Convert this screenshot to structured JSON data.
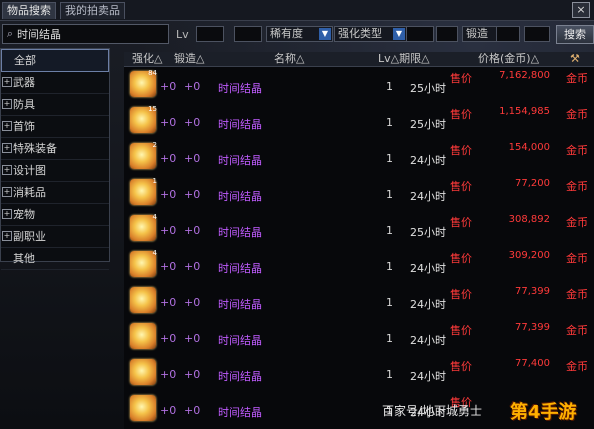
{
  "tabs": [
    {
      "label": "物品搜索"
    },
    {
      "label": "我的拍卖品"
    }
  ],
  "close_label": "×",
  "search": {
    "value": "时间结晶"
  },
  "filters": {
    "lv_label": "Lv",
    "rarity_label": "稀有度",
    "enhance_type_label": "强化类型",
    "forge_label": "锻造",
    "search_button": "搜索"
  },
  "categories": [
    {
      "label": "全部"
    },
    {
      "label": "武器"
    },
    {
      "label": "防具"
    },
    {
      "label": "首饰"
    },
    {
      "label": "特殊装备"
    },
    {
      "label": "设计图"
    },
    {
      "label": "消耗品"
    },
    {
      "label": "宠物"
    },
    {
      "label": "副职业"
    },
    {
      "label": "其他"
    }
  ],
  "columns": {
    "enhance": "强化△",
    "forge": "锻造△",
    "name": "名称△",
    "lv_expire": "Lv△期限△",
    "price": "价格(金币)△"
  },
  "rows": [
    {
      "count": "84",
      "enhance": "+0",
      "forge": "+0",
      "name": "时间结晶",
      "lv": "1",
      "expire": "25小时",
      "sell": "售价",
      "price": "7,162,800",
      "currency": "金币"
    },
    {
      "count": "15",
      "enhance": "+0",
      "forge": "+0",
      "name": "时间结晶",
      "lv": "1",
      "expire": "25小时",
      "sell": "售价",
      "price": "1,154,985",
      "currency": "金币"
    },
    {
      "count": "2",
      "enhance": "+0",
      "forge": "+0",
      "name": "时间结晶",
      "lv": "1",
      "expire": "24小时",
      "sell": "售价",
      "price": "154,000",
      "currency": "金币"
    },
    {
      "count": "1",
      "enhance": "+0",
      "forge": "+0",
      "name": "时间结晶",
      "lv": "1",
      "expire": "24小时",
      "sell": "售价",
      "price": "77,200",
      "currency": "金币"
    },
    {
      "count": "4",
      "enhance": "+0",
      "forge": "+0",
      "name": "时间结晶",
      "lv": "1",
      "expire": "25小时",
      "sell": "售价",
      "price": "308,892",
      "currency": "金币"
    },
    {
      "count": "4",
      "enhance": "+0",
      "forge": "+0",
      "name": "时间结晶",
      "lv": "1",
      "expire": "24小时",
      "sell": "售价",
      "price": "309,200",
      "currency": "金币"
    },
    {
      "count": "",
      "enhance": "+0",
      "forge": "+0",
      "name": "时间结晶",
      "lv": "1",
      "expire": "24小时",
      "sell": "售价",
      "price": "77,399",
      "currency": "金币"
    },
    {
      "count": "",
      "enhance": "+0",
      "forge": "+0",
      "name": "时间结晶",
      "lv": "1",
      "expire": "24小时",
      "sell": "售价",
      "price": "77,399",
      "currency": "金币"
    },
    {
      "count": "",
      "enhance": "+0",
      "forge": "+0",
      "name": "时间结晶",
      "lv": "1",
      "expire": "24小时",
      "sell": "售价",
      "price": "77,400",
      "currency": "金币"
    },
    {
      "count": "",
      "enhance": "+0",
      "forge": "+0",
      "name": "时间结晶",
      "lv": "1",
      "expire": "24小时",
      "sell": "售价",
      "price": "",
      "currency": ""
    }
  ],
  "watermark": "百家号/地下城勇士",
  "logo": "第4手游"
}
